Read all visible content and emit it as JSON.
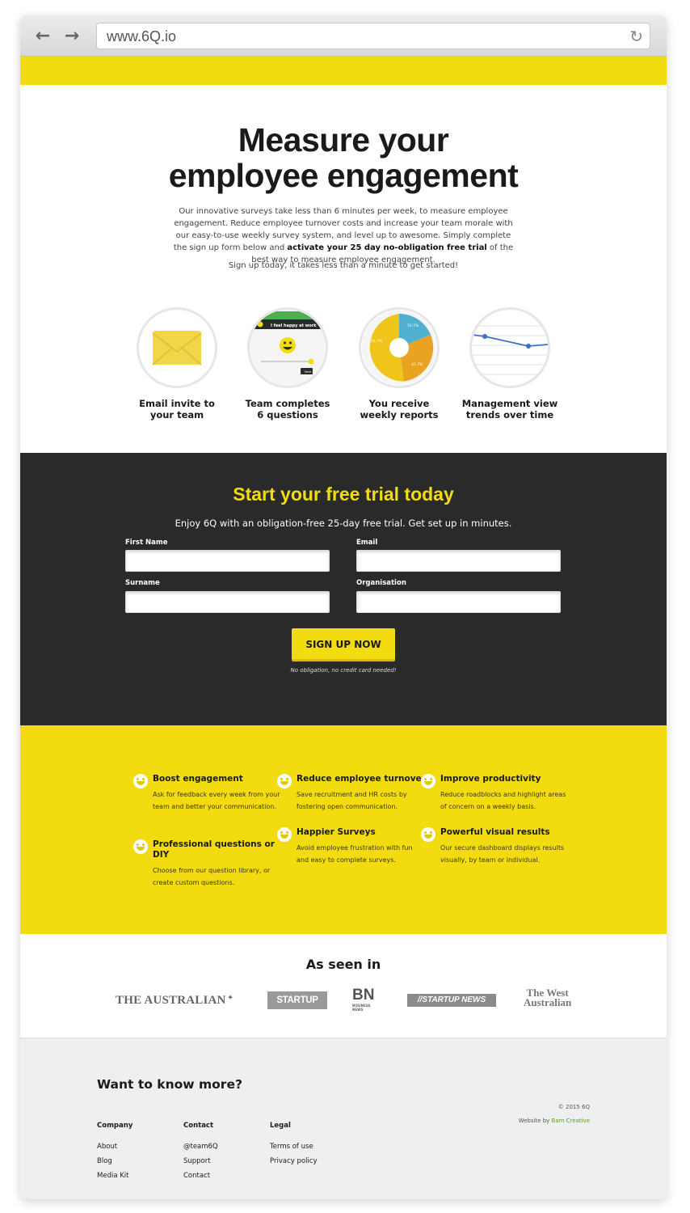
{
  "browser": {
    "url": "www.6Q.io",
    "back_icon": "←",
    "forward_icon": "→",
    "reload_icon": "↻"
  },
  "hero": {
    "title_line1": "Measure your",
    "title_line2": "employee engagement",
    "intro_part1": "Our innovative surveys take less than 6 minutes per week, to measure employee engagement. Reduce employee turnover costs and increase your team morale with our easy-to-use weekly survey system, and level up to awesome. Simply complete the sign up form below and ",
    "intro_bold": "activate your 25 day no-obligation free trial",
    "intro_part2": " of the best way to measure employee engagement.",
    "signup_note": "Sign up today, it takes less than a minute to get started!"
  },
  "steps": [
    {
      "line1": "Email invite to",
      "line2": "your team"
    },
    {
      "line1": "Team completes",
      "line2": "6 questions",
      "card_text": "I feel happy at work",
      "card_button": "Next ›"
    },
    {
      "line1": "You receive",
      "line2": "weekly reports",
      "pie_labels": [
        "10.7%",
        "41.7%",
        "41.7%"
      ]
    },
    {
      "line1": "Management view",
      "line2": "trends over time"
    }
  ],
  "trial": {
    "title": "Start your free trial today",
    "subtitle": "Enjoy 6Q with an obligation-free 25-day free trial. Get set up in minutes.",
    "first_name_label": "First Name",
    "email_label": "Email",
    "surname_label": "Surname",
    "organisation_label": "Organisation",
    "button_label": "SIGN UP NOW",
    "note": "No obligation, no credit card needed!"
  },
  "benefits": [
    {
      "title": "Boost engagement",
      "text": "Ask for feedback every week from your team and better your communication."
    },
    {
      "title": "Reduce employee turnover",
      "text": "Save recruitment and HR costs by fostering open communication."
    },
    {
      "title": "Improve productivity",
      "text": "Reduce roadblocks and highlight areas of concern on a weekly basis."
    },
    {
      "title": "Professional questions or DIY",
      "text": "Choose from our question library, or create custom questions."
    },
    {
      "title": "Happier Surveys",
      "text": "Avoid employee frustration with fun and easy to complete surveys."
    },
    {
      "title": "Powerful visual results",
      "text": "Our secure dashboard displays results visually, by team or individual."
    }
  ],
  "seen_in": {
    "title": "As seen in",
    "logos": [
      "THE AUSTRALIAN",
      "STARTUP DAILY",
      "BN",
      "BUSINESS NEWS",
      "//STARTUP NEWS",
      "The West",
      "Australian"
    ]
  },
  "footer": {
    "title": "Want to know more?",
    "company": {
      "heading": "Company",
      "links": [
        "About",
        "Blog",
        "Media Kit"
      ]
    },
    "contact": {
      "heading": "Contact",
      "links": [
        "@team6Q",
        "Support",
        "Contact"
      ]
    },
    "legal": {
      "heading": "Legal",
      "links": [
        "Terms of use",
        "Privacy policy"
      ]
    },
    "copyright": "© 2015 6Q",
    "credit_prefix": "Website by ",
    "credit_link": "Bam Creative"
  },
  "colors": {
    "brand_yellow": "#f2dc10",
    "dark": "#2a2a2b",
    "footer_bg": "#eef0f0"
  }
}
